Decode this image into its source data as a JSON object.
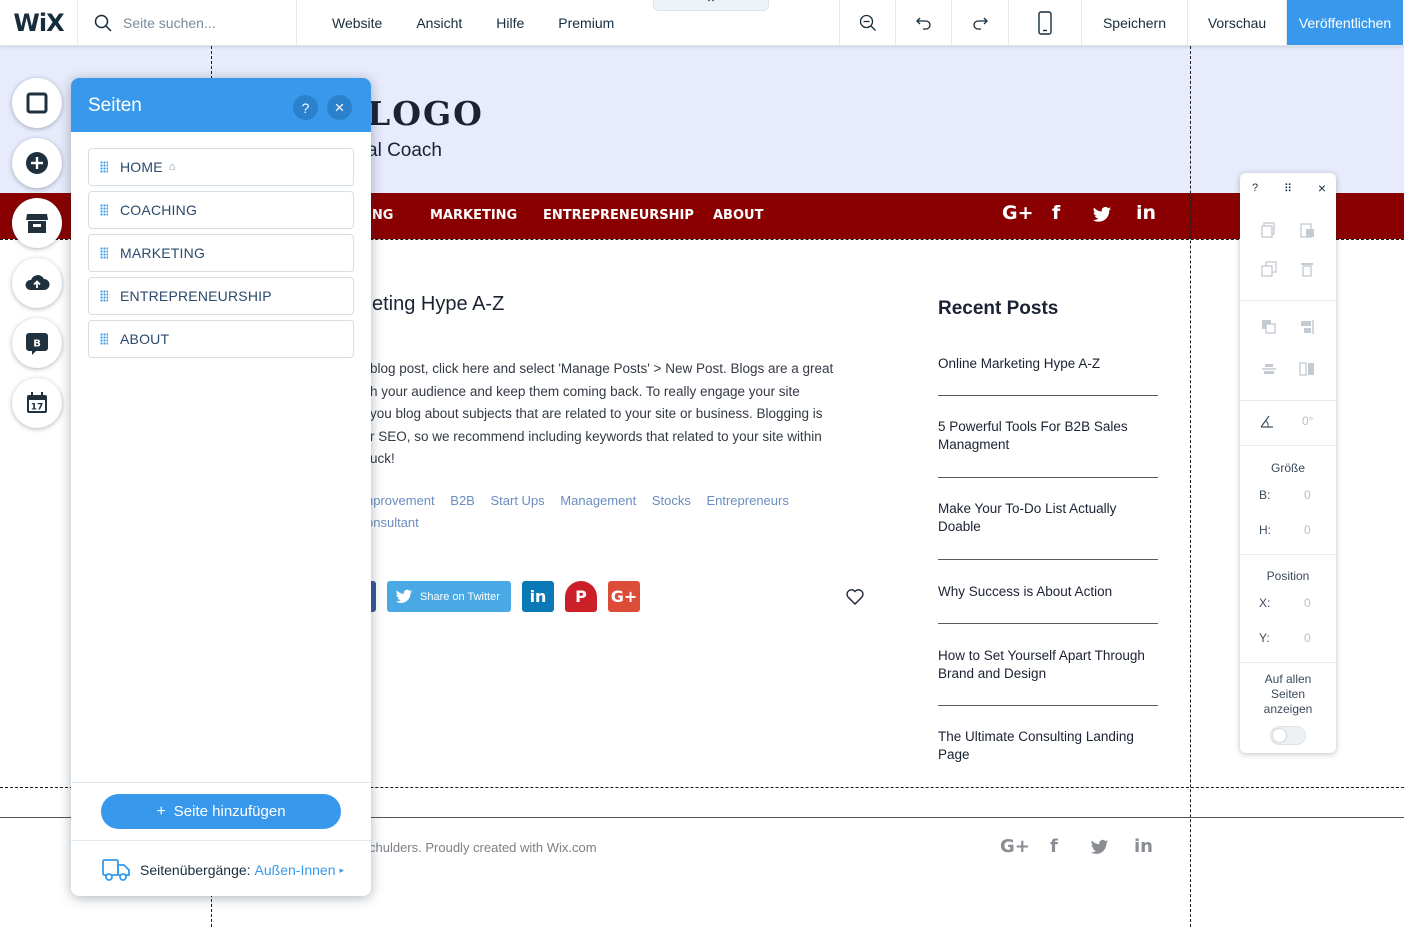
{
  "topbar": {
    "logo": "WiX",
    "search_placeholder": "Seite suchen...",
    "menu": [
      "Website",
      "Ansicht",
      "Hilfe",
      "Premium"
    ],
    "collapse_glyph": "⌃",
    "save_label": "Speichern",
    "preview_label": "Vorschau",
    "publish_label": "Veröffentlichen",
    "accent_color": "#3899ec"
  },
  "left_tools": [
    "page-background-icon",
    "add-icon",
    "store-icon",
    "upload-icon",
    "blog-icon",
    "calendar-icon"
  ],
  "left_tools_labels": {
    "blog": "B",
    "calendar": "17"
  },
  "pages_panel": {
    "title": "Seiten",
    "help": "?",
    "close": "×",
    "pages": [
      {
        "label": "HOME",
        "is_home": true
      },
      {
        "label": "COACHING"
      },
      {
        "label": "MARKETING"
      },
      {
        "label": "ENTREPRENEURSHIP"
      },
      {
        "label": "ABOUT"
      }
    ],
    "home_glyph": "⌂",
    "add_plus": "+",
    "add_page_label": "Seite hinzufügen",
    "transitions_label": "Seitenübergänge:",
    "transitions_value": "Außen-Innen",
    "transitions_caret": "▸"
  },
  "site": {
    "logo": "LOGO",
    "tagline": "al Coach",
    "nav": [
      "ING",
      "MARKETING",
      "ENTREPRENEURSHIP",
      "ABOUT"
    ],
    "nav_social": {
      "google": "G+",
      "facebook": "f",
      "linkedin": "in"
    },
    "header_bg": "#e7ebfb",
    "nav_bg": "#8a0000",
    "post": {
      "title": "eting Hype A-Z",
      "body": "blog post, click here and select 'Manage Posts' > New Post. Blogs are a great\nh your audience and keep them coming back. To really engage your site\n you blog about subjects that are related to your site or business. Blogging is\nr SEO, so we recommend including keywords that related to your site within\nuck!",
      "tags_row1": [
        "nprovement",
        "B2B",
        "Start Ups",
        "Management",
        "Stocks",
        "Entrepreneurs"
      ],
      "tags_row2": [
        "onsultant"
      ],
      "share_twitter": "Share on Twitter",
      "share_linkedin": "in",
      "share_pinterest": "P",
      "share_google": "G+"
    },
    "recent_posts": {
      "title": "Recent Posts",
      "items": [
        "Online Marketing Hype A-Z",
        "5 Powerful Tools For B2B Sales Managment",
        "Make Your To-Do List Actually Doable",
        "Why Success is About Action",
        "How to Set Yourself Apart Through Brand and Design",
        "The Ultimate Consulting Landing Page"
      ]
    },
    "footer_text": "chulders. Proudly created with Wix.com",
    "footer_social": {
      "google": "G+",
      "facebook": "f",
      "linkedin": "in"
    }
  },
  "inspector": {
    "help": "?",
    "drag": "⠿",
    "close": "×",
    "rotation_value": "0°",
    "size_label": "Größe",
    "width_key": "B:",
    "width_value": "0",
    "height_key": "H:",
    "height_value": "0",
    "position_label": "Position",
    "x_key": "X:",
    "x_value": "0",
    "y_key": "Y:",
    "y_value": "0",
    "show_all_label": "Auf allen Seiten anzeigen"
  }
}
